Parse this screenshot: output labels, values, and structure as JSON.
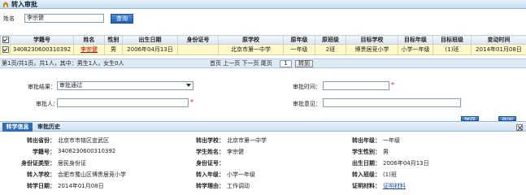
{
  "title": "转入审批",
  "search": {
    "name_label": "姓名",
    "name_value": "李宗健",
    "query_button": "查询"
  },
  "grid": {
    "headers": [
      "学籍号",
      "姓名",
      "性别",
      "出生日期",
      "身份证号",
      "原学校",
      "原年级",
      "原班级",
      "目标学校",
      "目标年级",
      "目标班级",
      "变动时间"
    ],
    "row": [
      "3408230600310392",
      "李宗健",
      "男",
      "2006年04月13日",
      "",
      "北京市第一中学",
      "一年级",
      "2班",
      "博贵居竞小学",
      "小学一年级",
      "(1)班",
      "2014年01月08日"
    ]
  },
  "pager": {
    "info": "第1页/共1页，共1人，其中：男生1人，女生0人",
    "first": "首页",
    "prev": "上一页",
    "next": "下一页",
    "last": "尾页",
    "page_value": "1",
    "go": "转到"
  },
  "form": {
    "result_label": "审批结果：",
    "result_value": "审批通过",
    "time_label": "审批时间：",
    "approver_label": "审批人：",
    "opinion_label": "审批意见：",
    "save_button": "保存",
    "back_button": "返回"
  },
  "tabs": [
    "转学信息",
    "审批历史"
  ],
  "detail": {
    "rows": [
      [
        [
          "转出省份：",
          "北京市市辖区宣武区"
        ],
        [
          "转出学校：",
          "北京市第一中学"
        ],
        [
          "转出年级：",
          "一年级"
        ]
      ],
      [
        [
          "学籍号：",
          "3408230600310392"
        ],
        [
          "学生姓名：",
          "李宗健"
        ],
        [
          "学生性别：",
          "男"
        ]
      ],
      [
        [
          "身份证类型：",
          "居民身份证"
        ],
        [
          "身份证号：",
          ""
        ],
        [
          "出生日期：",
          "2006年04月13日"
        ]
      ],
      [
        [
          "转入学校：",
          "合肥市蜀山区博贵居竞小学"
        ],
        [
          "转入年级：",
          "小学一年级"
        ],
        [
          "转入班级：",
          "(1)班"
        ]
      ],
      [
        [
          "转学日期：",
          "2014年01月08日"
        ],
        [
          "转学理由：",
          "工作调动"
        ],
        [
          "证明材料：",
          "证明材料"
        ]
      ]
    ]
  }
}
